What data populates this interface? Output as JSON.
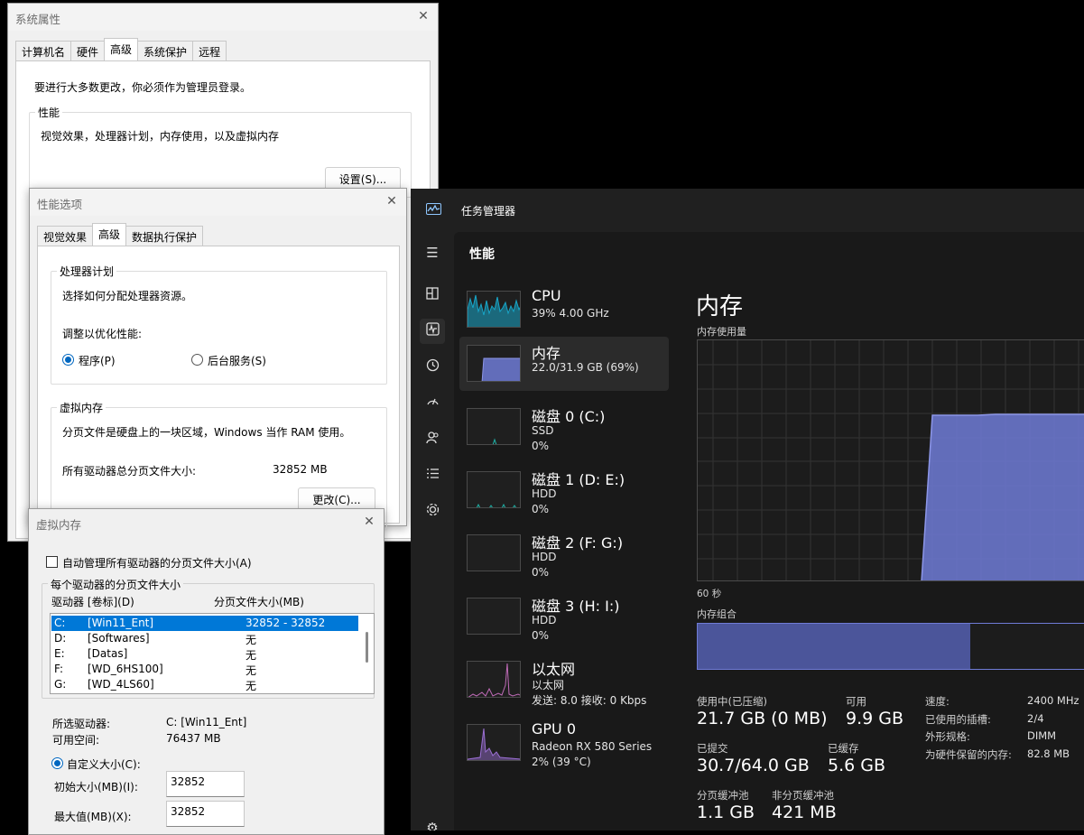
{
  "sysprops": {
    "title": "系统属性",
    "tabs": [
      "计算机名",
      "硬件",
      "高级",
      "系统保护",
      "远程"
    ],
    "admin_note": "要进行大多数更改，你必须作为管理员登录。",
    "perf_group": "性能",
    "perf_desc": "视觉效果，处理器计划，内存使用，以及虚拟内存",
    "settings_btn": "设置(S)..."
  },
  "perfopts": {
    "title": "性能选项",
    "tabs": [
      "视觉效果",
      "高级",
      "数据执行保护"
    ],
    "cpu_group": "处理器计划",
    "cpu_desc": "选择如何分配处理器资源。",
    "optimize_label": "调整以优化性能:",
    "radio_programs": "程序(P)",
    "radio_services": "后台服务(S)",
    "vm_group": "虚拟内存",
    "vm_desc": "分页文件是硬盘上的一块区域，Windows 当作 RAM 使用。",
    "total_label": "所有驱动器总分页文件大小:",
    "total_value": "32852 MB",
    "change_btn": "更改(C)..."
  },
  "vmem": {
    "title": "虚拟内存",
    "auto_manage": "自动管理所有驱动器的分页文件大小(A)",
    "per_drive_group": "每个驱动器的分页文件大小",
    "col_drive": "驱动器 [卷标](D)",
    "col_size": "分页文件大小(MB)",
    "drives": [
      {
        "letter": "C:",
        "label": "[Win11_Ent]",
        "size": "32852 - 32852"
      },
      {
        "letter": "D:",
        "label": "[Softwares]",
        "size": "无"
      },
      {
        "letter": "E:",
        "label": "[Datas]",
        "size": "无"
      },
      {
        "letter": "F:",
        "label": "[WD_6HS100]",
        "size": "无"
      },
      {
        "letter": "G:",
        "label": "[WD_4LS60]",
        "size": "无"
      }
    ],
    "selected_drive_label": "所选驱动器:",
    "selected_drive_value": "C:  [Win11_Ent]",
    "free_space_label": "可用空间:",
    "free_space_value": "76437 MB",
    "custom_size": "自定义大小(C):",
    "initial_label": "初始大小(MB)(I):",
    "initial_value": "32852",
    "max_label": "最大值(MB)(X):",
    "max_value": "32852"
  },
  "taskmgr": {
    "title": "任务管理器",
    "section": "性能",
    "resources": [
      {
        "name": "CPU",
        "line1": "39%  4.00 GHz",
        "line2": ""
      },
      {
        "name": "内存",
        "line1": "22.0/31.9 GB (69%)",
        "line2": ""
      },
      {
        "name": "磁盘 0 (C:)",
        "line1": "SSD",
        "line2": "0%"
      },
      {
        "name": "磁盘 1 (D: E:)",
        "line1": "HDD",
        "line2": "0%"
      },
      {
        "name": "磁盘 2 (F: G:)",
        "line1": "HDD",
        "line2": "0%"
      },
      {
        "name": "磁盘 3 (H: I:)",
        "line1": "HDD",
        "line2": "0%"
      },
      {
        "name": "以太网",
        "line1": "以太网",
        "line2": "发送: 8.0  接收: 0 Kbps"
      },
      {
        "name": "GPU 0",
        "line1": "Radeon RX 580 Series",
        "line2": "2% (39 °C)"
      }
    ],
    "detail_title": "内存",
    "usage_label": "内存使用量",
    "time_label": "60 秒",
    "composition_label": "内存组合",
    "memory_usage_percent": 69,
    "stats": {
      "in_use_label": "使用中(已压缩)",
      "in_use_value": "21.7 GB (0 MB)",
      "available_label": "可用",
      "available_value": "9.9 GB",
      "committed_label": "已提交",
      "committed_value": "30.7/64.0 GB",
      "cached_label": "已缓存",
      "cached_value": "5.6 GB",
      "paged_label": "分页缓冲池",
      "paged_value": "1.1 GB",
      "nonpaged_label": "非分页缓冲池",
      "nonpaged_value": "421 MB"
    },
    "specs": {
      "speed_label": "速度:",
      "speed_value": "2400 MHz",
      "slots_label": "已使用的插槽:",
      "slots_value": "2/4",
      "form_label": "外形规格:",
      "form_value": "DIMM",
      "reserved_label": "为硬件保留的内存:",
      "reserved_value": "82.8 MB"
    },
    "colors": {
      "cpu": "#17a6c9",
      "memory": "#6f7bd6",
      "disk": "#1fb3a8",
      "ethernet": "#c06bb8",
      "gpu": "#9b6fd4"
    }
  }
}
